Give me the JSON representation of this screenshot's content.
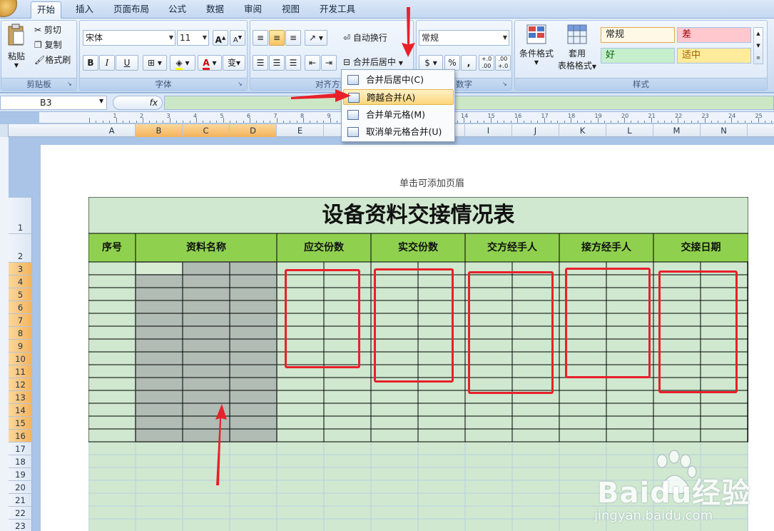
{
  "tabs": [
    "开始",
    "插入",
    "页面布局",
    "公式",
    "数据",
    "审阅",
    "视图",
    "开发工具"
  ],
  "clipboard": {
    "paste": "粘贴",
    "cut": "剪切",
    "copy": "复制",
    "format_painter": "格式刷",
    "label": "剪贴板"
  },
  "font": {
    "name": "宋体",
    "size": "11",
    "bold": "B",
    "italic": "I",
    "underline": "U",
    "color_letter": "A",
    "phonetic": "变",
    "label": "字体"
  },
  "alignment": {
    "wrap": "自动换行",
    "merge_center": "合并后居中",
    "label": "对齐方式"
  },
  "number": {
    "format": "常规",
    "percent": "%",
    "comma": ",",
    "inc": "+.0 .00",
    "dec": ".00 +.0",
    "label": "数字"
  },
  "styles": {
    "cond_format": "条件格式",
    "table_format_1": "套用",
    "table_format_2": "表格格式",
    "normal": "常规",
    "bad": "差",
    "good": "好",
    "neutral": "适中",
    "label": "样式"
  },
  "namebox": "B3",
  "fx": "fx",
  "menu": {
    "items": [
      "合并后居中(C)",
      "跨越合并(A)",
      "合并单元格(M)",
      "取消单元格合并(U)"
    ],
    "highlighted": 1
  },
  "columns": [
    "A",
    "B",
    "C",
    "D",
    "E",
    "F",
    "G",
    "H",
    "I",
    "J",
    "K",
    "L",
    "M",
    "N"
  ],
  "selected_columns": [
    "B",
    "C",
    "D"
  ],
  "rows": [
    "1",
    "2",
    "3",
    "4",
    "5",
    "6",
    "7",
    "8",
    "9",
    "10",
    "11",
    "12",
    "13",
    "14",
    "15",
    "16",
    "17",
    "18",
    "19",
    "20",
    "21",
    "22",
    "23"
  ],
  "selected_rows": [
    "3",
    "4",
    "5",
    "6",
    "7",
    "8",
    "9",
    "10",
    "11",
    "12",
    "13",
    "14",
    "15",
    "16"
  ],
  "ruler_numbers": [
    "1",
    "2",
    "3",
    "4",
    "5",
    "6",
    "7",
    "8",
    "9",
    "10",
    "11",
    "12",
    "13",
    "14",
    "15",
    "16",
    "17",
    "18",
    "19",
    "20",
    "21",
    "22",
    "23",
    "24",
    "25",
    "26"
  ],
  "header_hint": "单击可添加页眉",
  "sheet": {
    "title": "设备资料交接情况表",
    "headers": [
      "序号",
      "资料名称",
      "应交份数",
      "实交份数",
      "交方经手人",
      "接方经手人",
      "交接日期"
    ]
  },
  "watermark": {
    "brand": "Baidu经验",
    "url": "jingyan.baidu.com"
  },
  "colors": {
    "sheet_fill": "#cfe8cf",
    "header_fill": "#8fd14f",
    "selection": "#b0bcb4",
    "annotation": "#e8202a",
    "accent": "#f4b25a"
  }
}
